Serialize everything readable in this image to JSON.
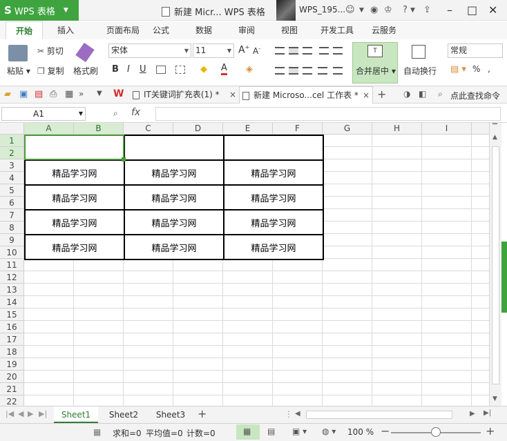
{
  "app": {
    "name": "WPS 表格",
    "window_title": "新建 Micr... WPS 表格",
    "user": "WPS_195..."
  },
  "ribbon_tabs": [
    "开始",
    "插入",
    "页面布局",
    "公式",
    "数据",
    "审阅",
    "视图",
    "开发工具",
    "云服务"
  ],
  "clipboard": {
    "paste": "粘贴",
    "cut": "剪切",
    "copy": "复制",
    "format_painter": "格式刷"
  },
  "font": {
    "family": "宋体",
    "size": "11",
    "bold": "B",
    "italic": "I",
    "underline": "U",
    "font_color_letter": "A"
  },
  "alignment": {
    "merge_center": "合并居中",
    "wrap_text": "自动换行",
    "merge_icon_letter": "T"
  },
  "number_format": {
    "value": "常规",
    "percent": "%"
  },
  "doc_tabs": [
    {
      "label": "IT关键词扩充表(1) *"
    },
    {
      "label": "新建 Microso...cel 工作表 *"
    }
  ],
  "search_command": "点此查找命令",
  "formula_bar": {
    "cell_ref": "A1",
    "fx": "fx",
    "value": ""
  },
  "columns": [
    "A",
    "B",
    "C",
    "D",
    "E",
    "F",
    "G",
    "H",
    "I"
  ],
  "rows": [
    "1",
    "2",
    "3",
    "4",
    "5",
    "6",
    "7",
    "8",
    "9",
    "10",
    "11",
    "12",
    "13",
    "14",
    "15",
    "16",
    "17",
    "18",
    "19",
    "20",
    "21",
    "22"
  ],
  "cells": [
    [
      "",
      "",
      ""
    ],
    [
      "精品学习网",
      "精品学习网",
      "精品学习网"
    ],
    [
      "精品学习网",
      "精品学习网",
      "精品学习网"
    ],
    [
      "精品学习网",
      "精品学习网",
      "精品学习网"
    ],
    [
      "精品学习网",
      "精品学习网",
      "精品学习网"
    ]
  ],
  "sheets": [
    "Sheet1",
    "Sheet2",
    "Sheet3"
  ],
  "status": {
    "sum": "求和=0",
    "average": "平均值=0",
    "count": "计数=0",
    "zoom": "100 %"
  },
  "colors": {
    "accent": "#3fa43f",
    "active_tab_text": "#2e7d32",
    "selected_header": "#d8ecd3"
  }
}
